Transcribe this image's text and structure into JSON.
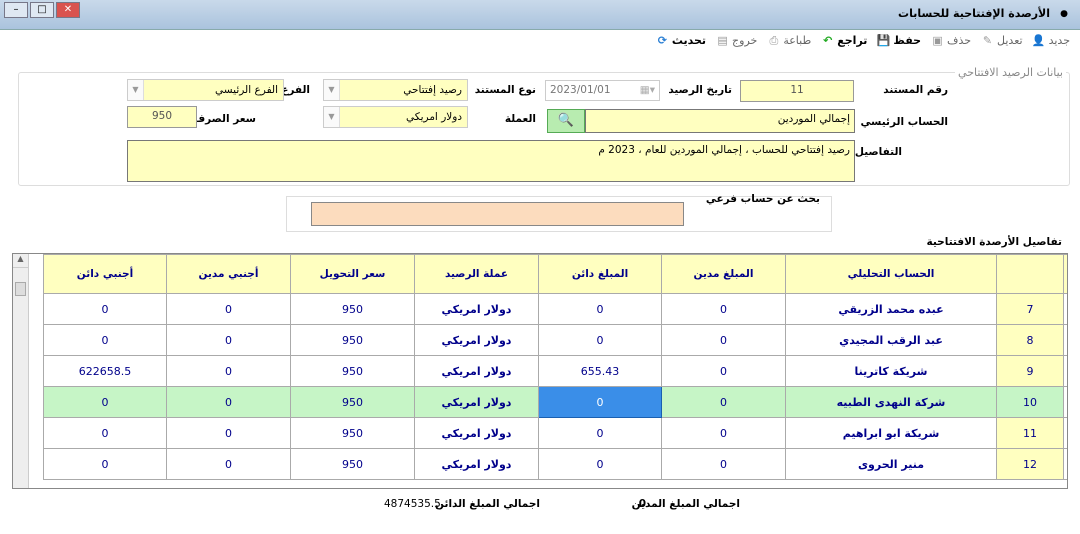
{
  "window": {
    "title": "الأرصدة الإفتتاحية للحسابات"
  },
  "toolbar": [
    {
      "label": "جديد",
      "icon": "user-add-icon",
      "state": "disabled"
    },
    {
      "label": "تعديل",
      "icon": "edit-icon",
      "state": "disabled"
    },
    {
      "label": "حذف",
      "icon": "delete-icon",
      "state": "disabled"
    },
    {
      "label": "حفظ",
      "icon": "save-icon",
      "state": "enabled"
    },
    {
      "label": "تراجع",
      "icon": "undo-icon",
      "state": "enabled"
    },
    {
      "label": "طباعة",
      "icon": "print-icon",
      "state": "disabled"
    },
    {
      "label": "خروج",
      "icon": "exit-icon",
      "state": "disabled"
    },
    {
      "label": "تحديث",
      "icon": "refresh-icon",
      "state": "enabled"
    }
  ],
  "form": {
    "group_title": "بيانات الرصيد الافتتاحي",
    "doc_no_label": "رقم المستند",
    "doc_no": "11",
    "date_label": "تاريخ الرصيد",
    "date": "2023/01/01",
    "doc_type_label": "نوع المستند",
    "doc_type": "رصيد إفتتاحي",
    "branch_label": "الفرع",
    "branch": "الفرع الرئيسي",
    "main_account_label": "الحساب الرئيسي",
    "main_account": "إجمالي الموردين",
    "currency_label": "العملة",
    "currency": "دولار امريكي",
    "rate_label": "سعر الصرف",
    "rate": "950",
    "details_label": "التفاصيل",
    "details": "رصيد إفتتاحي للحساب ، إجمالي الموردين  للعام ، 2023 م"
  },
  "search": {
    "label": "بحث عن حساب فرعي",
    "value": ""
  },
  "grid": {
    "title": "تفاصيل الأرصدة الافتتاحية",
    "columns": [
      "الحساب التحليلي",
      "المبلغ مدين",
      "المبلغ دائن",
      "عملة الرصيد",
      "سعر التحويل",
      "أجنبي مدين",
      "أجنبي دائن"
    ],
    "rows": [
      {
        "no": "7",
        "account": "عبده محمد الزريقي",
        "debit": "0",
        "credit": "0",
        "currency": "دولار امريكي",
        "rate": "950",
        "fdebit": "0",
        "fcredit": "0"
      },
      {
        "no": "8",
        "account": "عبد الرقب المجيدي",
        "debit": "0",
        "credit": "0",
        "currency": "دولار امريكي",
        "rate": "950",
        "fdebit": "0",
        "fcredit": "0"
      },
      {
        "no": "9",
        "account": "شريكة كاترينا",
        "debit": "0",
        "credit": "655.43",
        "currency": "دولار امريكي",
        "rate": "950",
        "fdebit": "0",
        "fcredit": "622658.5"
      },
      {
        "no": "10",
        "account": "شركة النهدى الطبيه",
        "debit": "0",
        "credit": "0",
        "currency": "دولار امريكي",
        "rate": "950",
        "fdebit": "0",
        "fcredit": "0",
        "selected": true
      },
      {
        "no": "11",
        "account": "شريكة ابو ابراهيم",
        "debit": "0",
        "credit": "0",
        "currency": "دولار امريكي",
        "rate": "950",
        "fdebit": "0",
        "fcredit": "0"
      },
      {
        "no": "12",
        "account": "منير الحروى",
        "debit": "0",
        "credit": "0",
        "currency": "دولار امريكي",
        "rate": "950",
        "fdebit": "0",
        "fcredit": "0"
      }
    ]
  },
  "totals": {
    "debit_label": "اجمالي المبلغ المدين",
    "debit": "0",
    "credit_label": "اجمالي المبلغ الدائن",
    "credit": "4874535.5"
  }
}
